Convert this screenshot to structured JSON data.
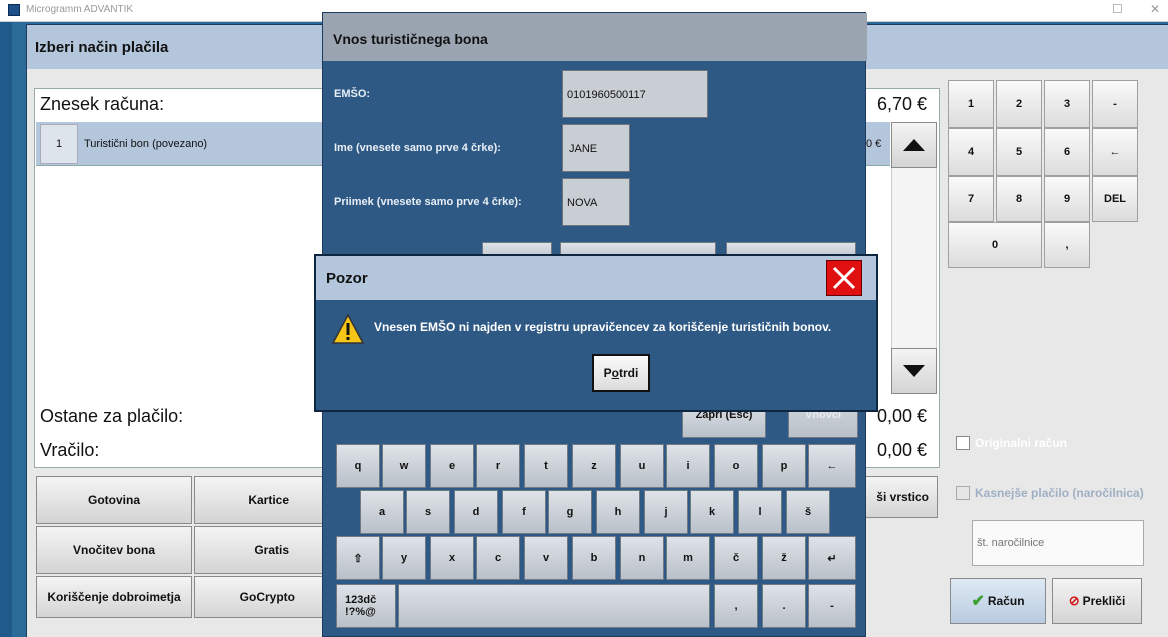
{
  "window": {
    "app_title": "Microgramm ADVANTIK"
  },
  "payment_dialog": {
    "title": "Izberi način plačila",
    "amount_label": "Znesek računa:",
    "amount_value": "6,70 €",
    "items": [
      {
        "index": "1",
        "name": "Turistični bon (povezano)",
        "value": "0 €"
      }
    ],
    "remaining_label": "Ostane za plačilo:",
    "remaining_value": "0,00 €",
    "change_label": "Vračilo:",
    "change_value": "0,00 €",
    "methods": [
      "Gotovina",
      "Kartice",
      "Vnočitev bona",
      "Gratis",
      "Koriščenje dobroimetja",
      "GoCrypto"
    ],
    "delete_row_label": "ši vrstico",
    "numpad": {
      "row1": [
        "1",
        "2",
        "3",
        "-"
      ],
      "row2": [
        "4",
        "5",
        "6",
        "←"
      ],
      "row3": [
        "7",
        "8",
        "9",
        "DEL"
      ],
      "row4": [
        "0",
        ","
      ]
    },
    "original_receipt_label": "Originalni račun",
    "later_payment_label": "Kasnejše plačilo (naročilnica)",
    "order_number_placeholder": "št. naročilnice",
    "confirm_label": "Račun",
    "cancel_label": "Prekliči"
  },
  "voucher_dialog": {
    "title": "Vnos turističnega bona",
    "emso_label": "EMŠO:",
    "emso_value": "0101960500117",
    "name_label": "Ime (vnesete samo prve 4 črke):",
    "name_value": "JANE",
    "surname_label": "Priimek (vnesete samo prve 4 črke):",
    "surname_value": "NOVA",
    "close_label": "Zapri (Esc)",
    "insert_label": "Vnovči",
    "keyboard": {
      "row1": [
        "q",
        "w",
        "e",
        "r",
        "t",
        "z",
        "u",
        "i",
        "o",
        "p",
        "←"
      ],
      "row2": [
        "a",
        "s",
        "d",
        "f",
        "g",
        "h",
        "j",
        "k",
        "l",
        "š"
      ],
      "row3": [
        "⇧",
        "y",
        "x",
        "c",
        "v",
        "b",
        "n",
        "m",
        "č",
        "ž",
        "↵"
      ],
      "row4_left_line1": "123dč",
      "row4_left_line2": "!?%@",
      "row4_keys": [
        ",",
        ".",
        "-"
      ]
    }
  },
  "alert": {
    "title": "Pozor",
    "message": "Vnesen EMŠO ni najden v registru upravičencev za koriščenje turističnih bonov.",
    "button_label_pre": "P",
    "button_label_underlined": "o",
    "button_label_post": "trdi"
  },
  "colors": {
    "dialog_header": "#b3c6dc",
    "dark_blue": "#2f5985",
    "alert_close": "#e01010"
  }
}
